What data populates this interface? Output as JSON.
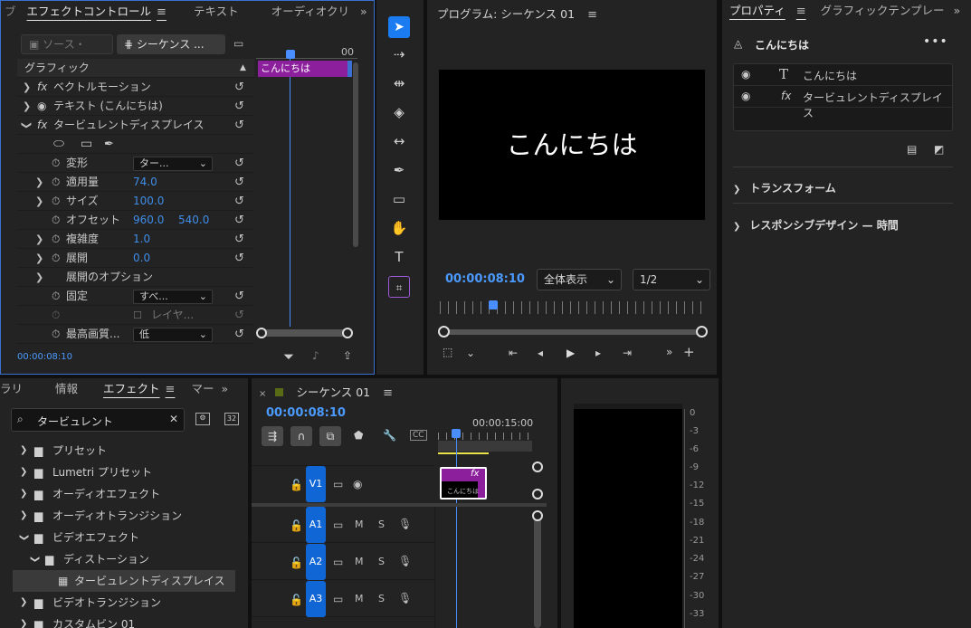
{
  "effect_controls": {
    "tabs": [
      {
        "label": "エフェクトコントロール"
      },
      {
        "label": "テキスト"
      },
      {
        "label": "オーディオクリ"
      }
    ],
    "source_btn": "ソース・",
    "sequence_btn": "シーケンス ...",
    "ruler_label": "00",
    "section": "グラフィック",
    "clip_label": "こんにちは",
    "rows": [
      {
        "label": "ベクトルモーション"
      },
      {
        "label": "テキスト (こんにちは)"
      },
      {
        "label": "タービュレントディスプレイス"
      },
      {
        "label": "変形",
        "dropdown": "ター..."
      },
      {
        "label": "適用量",
        "value": "74.0"
      },
      {
        "label": "サイズ",
        "value": "100.0"
      },
      {
        "label": "オフセット",
        "value": "960.0",
        "value2": "540.0"
      },
      {
        "label": "複雑度",
        "value": "1.0"
      },
      {
        "label": "展開",
        "value": "0.0"
      },
      {
        "label": "展開のオプション"
      },
      {
        "label": "固定",
        "dropdown": "すべ..."
      },
      {
        "label": "レイヤ..."
      },
      {
        "label": "最高画質...",
        "dropdown": "低"
      }
    ],
    "timecode": "00:00:08:10"
  },
  "program": {
    "title": "プログラム: シーケンス 01",
    "video_text": "こんにちは",
    "timecode": "00:00:08:10",
    "zoom": "全体表示",
    "resolution": "1/2"
  },
  "properties": {
    "tabs": [
      {
        "label": "プロパティ"
      },
      {
        "label": "グラフィックテンプレー"
      }
    ],
    "object_title": "こんにちは",
    "layers": [
      {
        "label": "こんにちは",
        "icon": "T"
      },
      {
        "label": "タービュレントディスプレイス",
        "icon": "fx"
      }
    ],
    "sections": [
      {
        "label": "トランスフォーム"
      },
      {
        "label": "レスポンシブデザイン — 時間"
      }
    ]
  },
  "effects": {
    "tabs": [
      {
        "label": "ラリ"
      },
      {
        "label": "情報"
      },
      {
        "label": "エフェクト"
      },
      {
        "label": "マー"
      }
    ],
    "search_value": "タービュレント",
    "items": [
      {
        "label": "プリセット"
      },
      {
        "label": "Lumetri プリセット"
      },
      {
        "label": "オーディオエフェクト"
      },
      {
        "label": "オーディオトランジション"
      },
      {
        "label": "ビデオエフェクト"
      },
      {
        "label": "ディストーション"
      },
      {
        "label": "タービュレントディスプレイス"
      },
      {
        "label": "ビデオトランジション"
      },
      {
        "label": "カスタムビン 01"
      }
    ]
  },
  "timeline": {
    "tab": "シーケンス 01",
    "timecode": "00:00:08:10",
    "ruler_label": "00:00:15:00",
    "tracks": [
      {
        "name": "V1"
      },
      {
        "name": "A1"
      },
      {
        "name": "A2"
      },
      {
        "name": "A3"
      }
    ],
    "track_m": "M",
    "track_s": "S",
    "clip_thumb_text": "こんにちは",
    "clip_fx": "fx"
  },
  "meters": {
    "scale": [
      "0",
      "-3",
      "-6",
      "-9",
      "-12",
      "-15",
      "-18",
      "-21",
      "-24",
      "-27",
      "-30",
      "-33"
    ]
  },
  "colors": {
    "accent": "#2d8ceb",
    "clip": "#8b1f9c",
    "track": "#1166d6"
  }
}
